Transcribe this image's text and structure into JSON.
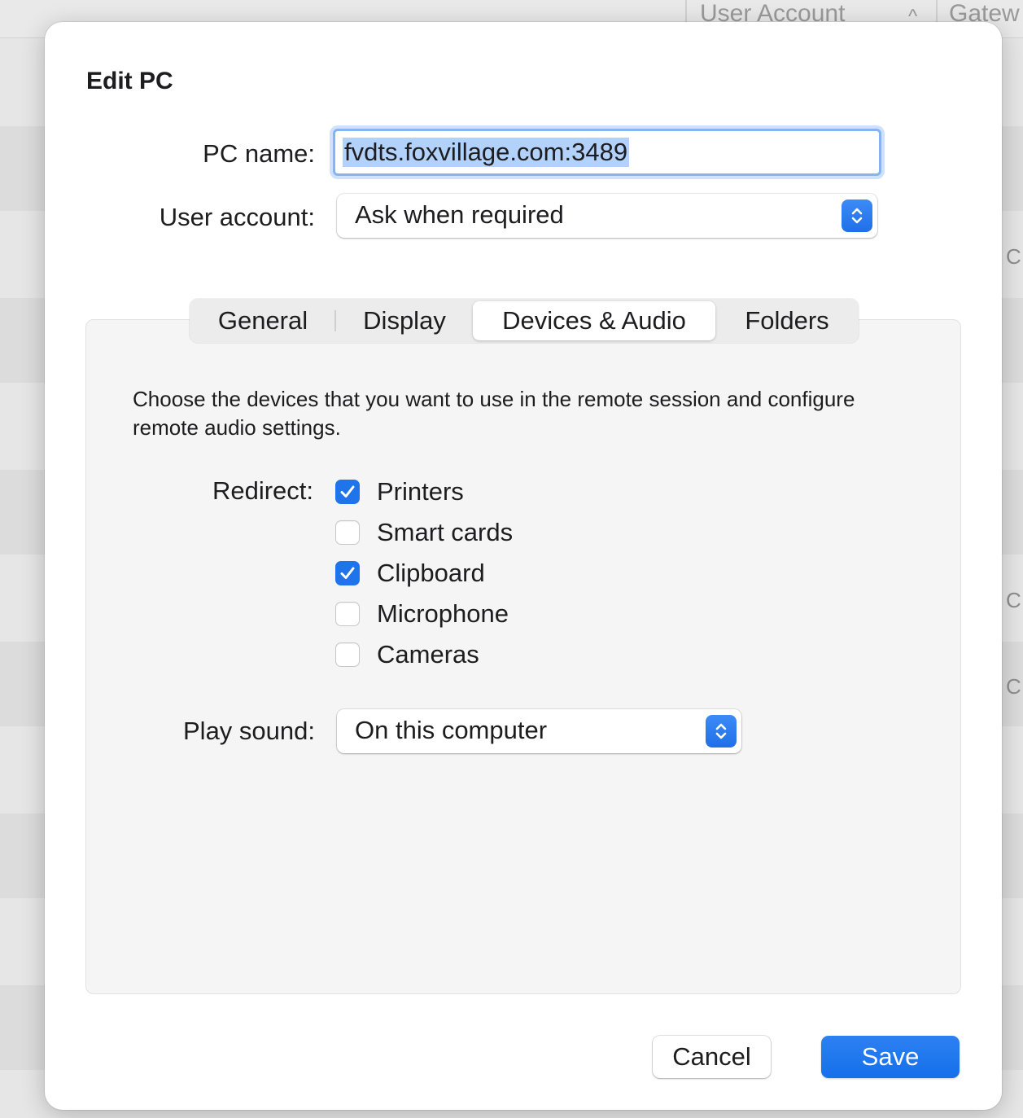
{
  "background": {
    "columns": [
      "User Account",
      "Gatew"
    ],
    "sort_glyph": "^",
    "row_fragments": [
      "C",
      "C",
      "C"
    ]
  },
  "dialog": {
    "title": "Edit PC",
    "pc_name": {
      "label": "PC name:",
      "value": "fvdts.foxvillage.com:3489"
    },
    "user_account": {
      "label": "User account:",
      "value": "Ask when required"
    },
    "tabs": [
      {
        "label": "General",
        "active": false
      },
      {
        "label": "Display",
        "active": false
      },
      {
        "label": "Devices & Audio",
        "active": true
      },
      {
        "label": "Folders",
        "active": false
      }
    ],
    "description": "Choose the devices that you want to use in the remote session and configure remote audio settings.",
    "redirect": {
      "label": "Redirect:",
      "options": [
        {
          "label": "Printers",
          "checked": true
        },
        {
          "label": "Smart cards",
          "checked": false
        },
        {
          "label": "Clipboard",
          "checked": true
        },
        {
          "label": "Microphone",
          "checked": false
        },
        {
          "label": "Cameras",
          "checked": false
        }
      ]
    },
    "play_sound": {
      "label": "Play sound:",
      "value": "On this computer"
    },
    "cancel_label": "Cancel",
    "save_label": "Save"
  },
  "colors": {
    "accent": "#1f74ec",
    "selection": "#b2d2fb"
  }
}
